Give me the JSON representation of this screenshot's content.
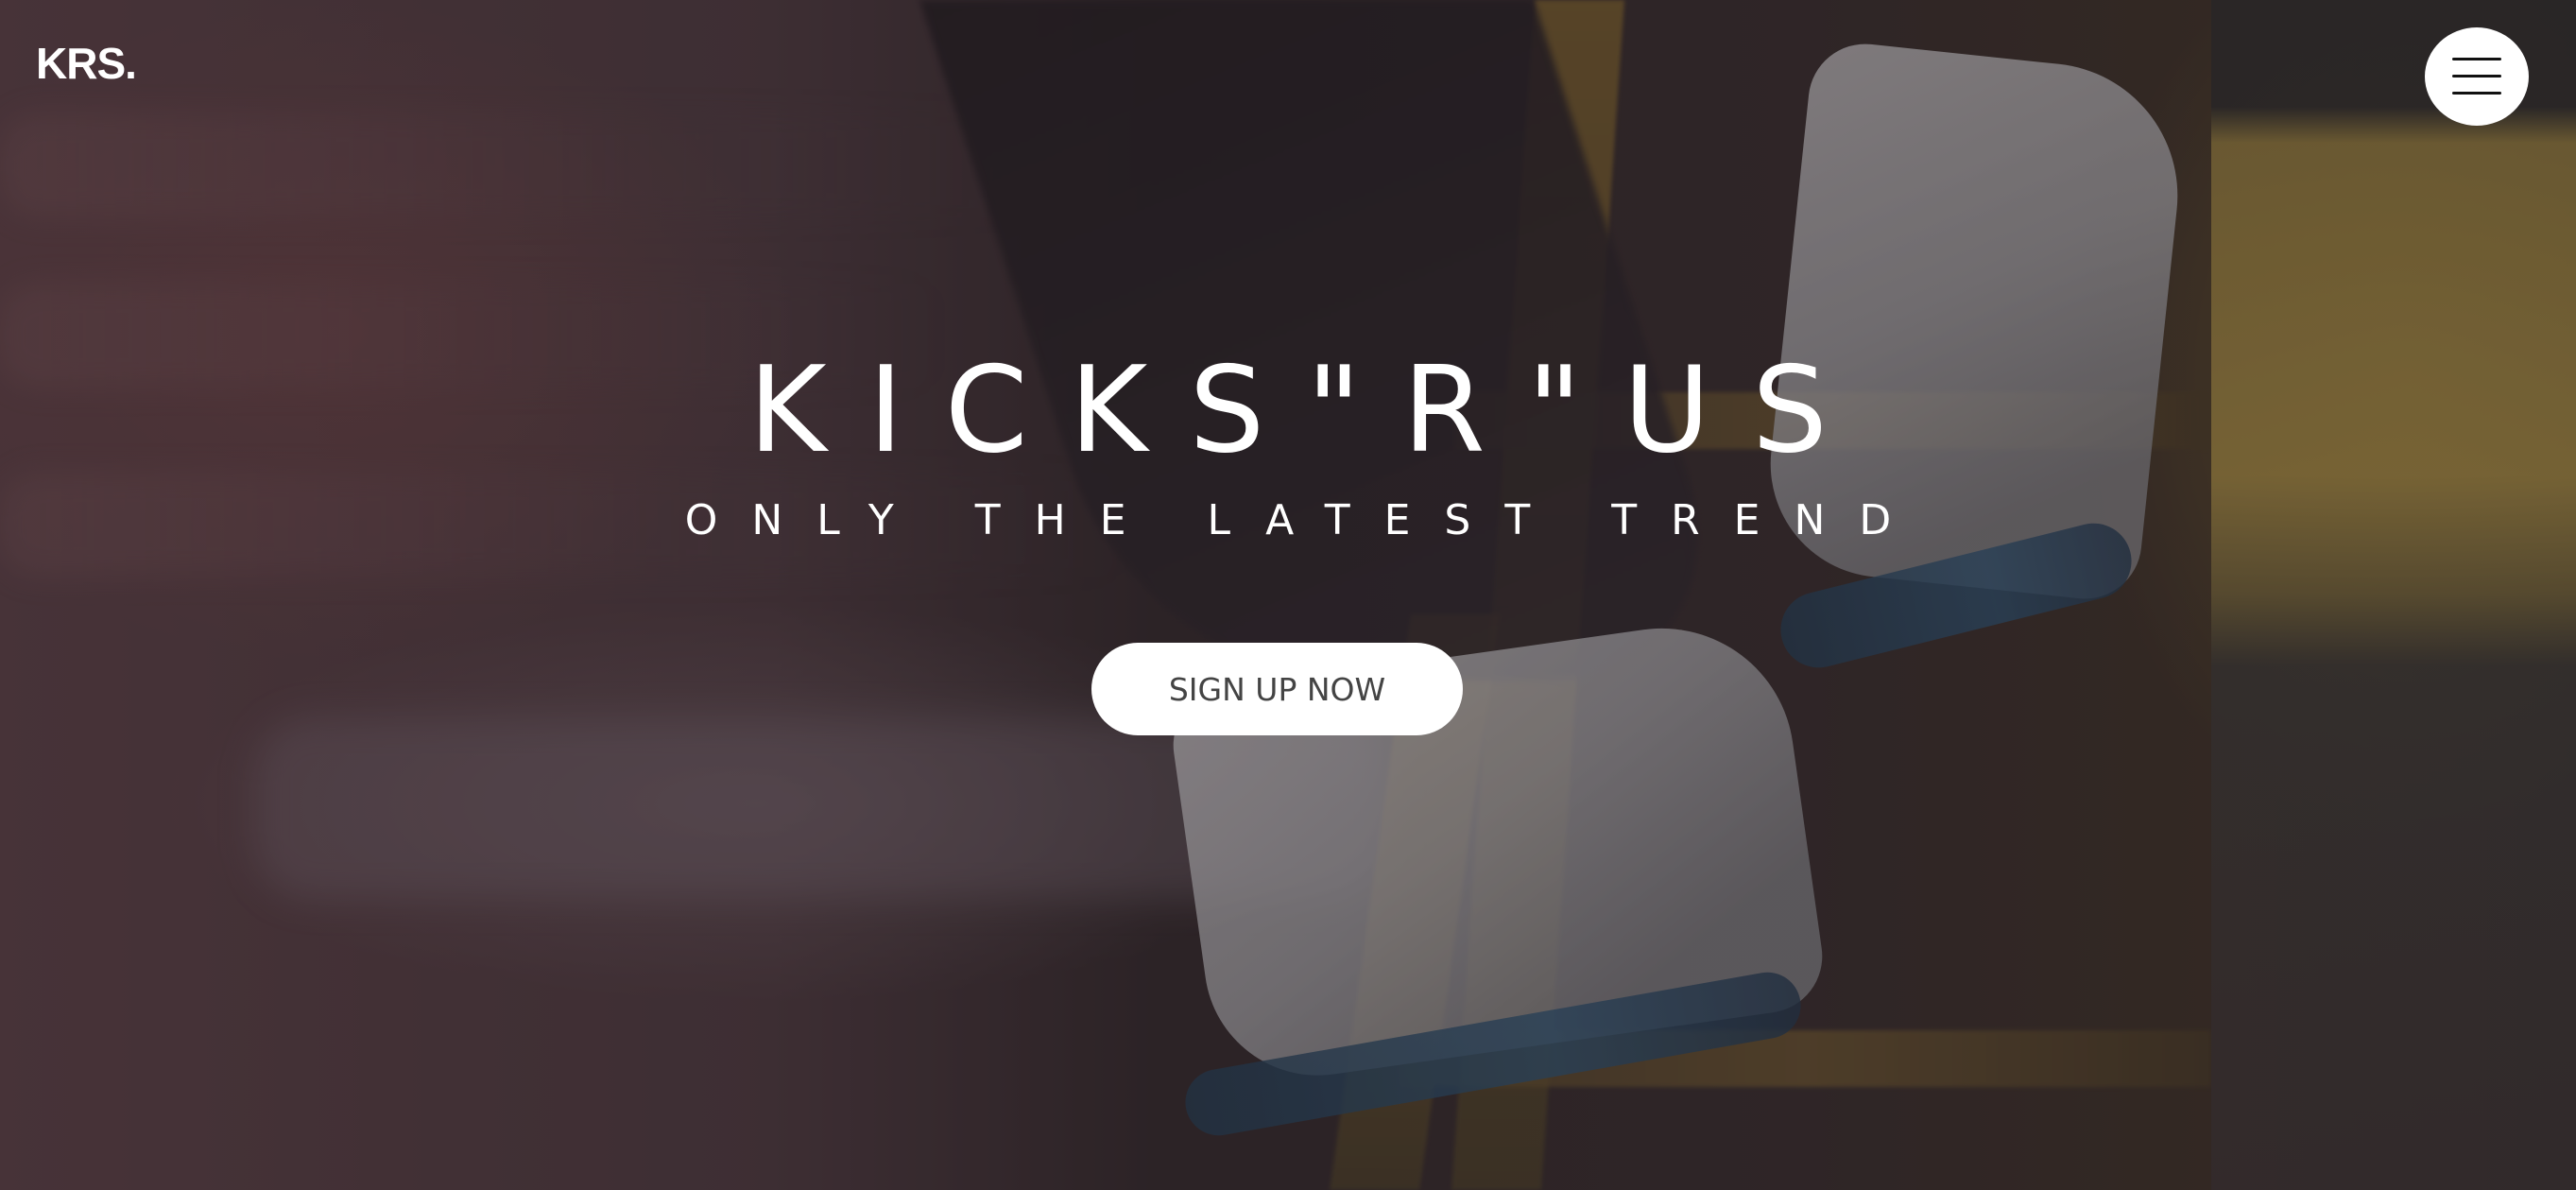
{
  "header": {
    "logo_text": "KRS.",
    "menu_icon": "hamburger-menu-icon"
  },
  "hero": {
    "title": "KICKS\"R\"US",
    "subtitle": "ONLY THE LATEST TREND",
    "cta_label": "SIGN UP NOW"
  },
  "colors": {
    "text": "#ffffff",
    "button_bg": "#ffffff",
    "button_text": "#444444"
  }
}
